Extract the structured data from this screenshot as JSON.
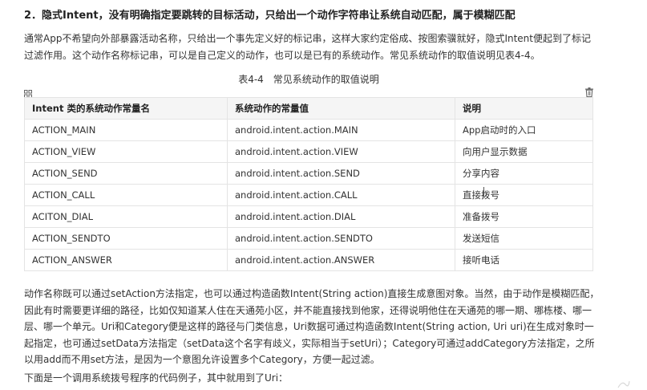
{
  "heading": "2．隐式Intent，没有明确指定要跳转的目标活动，只给出一个动作字符串让系统自动匹配，属于模糊匹配",
  "intro": "通常App不希望向外部暴露活动名称，只给出一个事先定义好的标记串，这样大家约定俗成、按图索骥就好，隐式Intent便起到了标记过滤作用。这个动作名称标记串，可以是自己定义的动作，也可以是已有的系统动作。常见系统动作的取值说明见表4-4。",
  "table": {
    "caption": "表4-4　常见系统动作的取值说明",
    "headers": [
      "Intent 类的系统动作常量名",
      "系统动作的常量值",
      "说明"
    ],
    "rows": [
      [
        "ACTION_MAIN",
        "android.intent.action.MAIN",
        "App启动时的入口"
      ],
      [
        "ACTION_VIEW",
        "android.intent.action.VIEW",
        "向用户显示数据"
      ],
      [
        "ACTION_SEND",
        "android.intent.action.SEND",
        "分享内容"
      ],
      [
        "ACTION_CALL",
        "android.intent.action.CALL",
        "直接拨号"
      ],
      [
        "ACITON_DIAL",
        "android.intent.action.DIAL",
        "准备拨号"
      ],
      [
        "ACTION_SENDTO",
        "android.intent.action.SENDTO",
        "发送短信"
      ],
      [
        "ACTION_ANSWER",
        "android.intent.action.ANSWER",
        "接听电话"
      ]
    ]
  },
  "body": "动作名称既可以通过setAction方法指定，也可以通过构造函数Intent(String action)直接生成意图对象。当然，由于动作是模糊匹配，因此有时需要更详细的路径，比如仅知道某人住在天通苑小区，并不能直接找到他家，还得说明他住在天通苑的哪一期、哪栋楼、哪一层、哪一个单元。Uri和Category便是这样的路径与门类信息，Uri数据可通过构造函数Intent(String action, Uri uri)在生成对象时一起指定，也可通过setData方法指定（setData这个名字有歧义，实际相当于setUri）；Category可通过addCategory方法指定，之所以用add而不用set方法，是因为一个意图允许设置多个Category，方便一起过滤。",
  "footer": "下面是一个调用系统拨号程序的代码例子，其中就用到了Uri：",
  "icons": {
    "left": "table-grid-icon",
    "right": "trash-icon",
    "corner": "scroll-mark-icon"
  }
}
